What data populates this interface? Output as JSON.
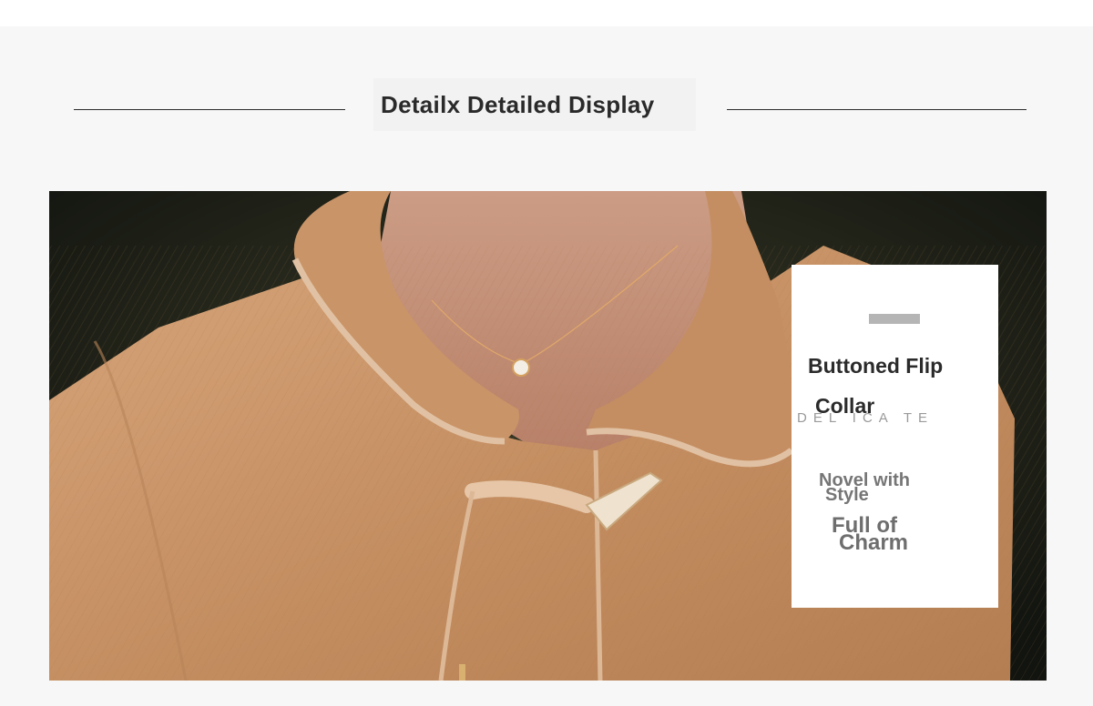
{
  "header": {
    "title": "Detailx Detailed Display"
  },
  "detail_card": {
    "title_line_1": "Buttoned Flip",
    "title_line_2": "Collar",
    "spaced_word": "DEL ICA TE",
    "sub_line_1": "Novel with",
    "sub_line_2": "Style",
    "charm_line_1": "Full of",
    "charm_line_2": "Charm"
  },
  "colors": {
    "page_background": "#f7f7f7",
    "coat_tan": "#c99467",
    "card_background": "#ffffff",
    "title_text": "#2a2a2a"
  }
}
